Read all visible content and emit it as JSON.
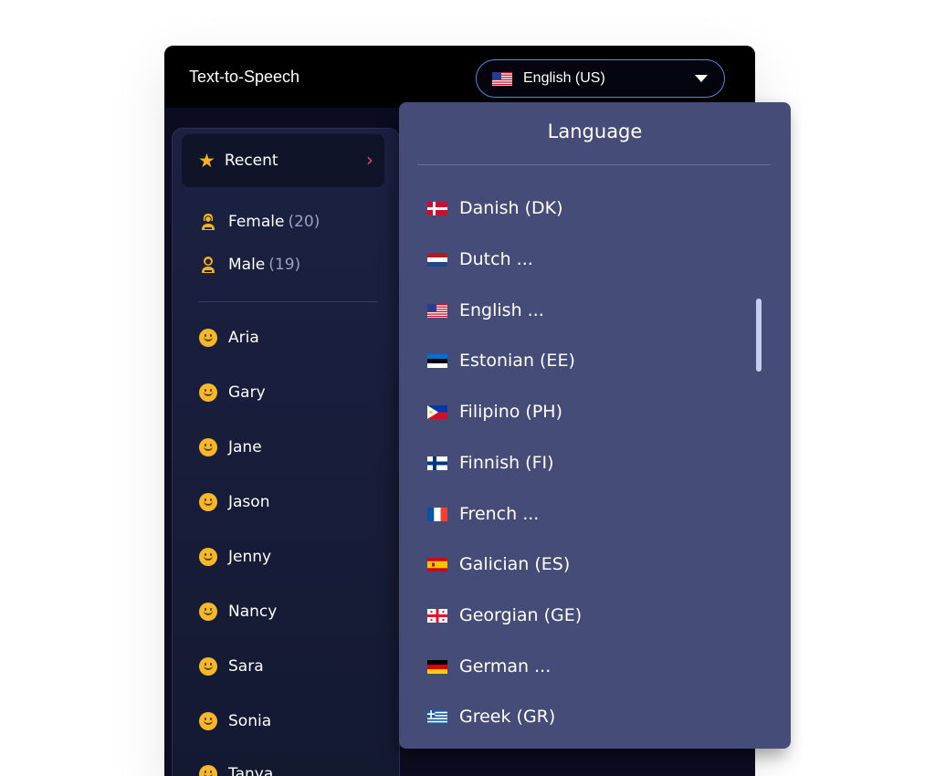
{
  "header": {
    "title": "Text-to-Speech",
    "language_select": {
      "value": "English (US)",
      "flag": "flag-us-icon"
    }
  },
  "sidebar": {
    "recent": {
      "label": "Recent",
      "icon": "star-icon"
    },
    "filters": [
      {
        "label": "Female",
        "count": "(20)",
        "icon": "female-icon"
      },
      {
        "label": "Male",
        "count": "(19)",
        "icon": "male-icon"
      }
    ],
    "voices": [
      "Aria",
      "Gary",
      "Jane",
      "Jason",
      "Jenny",
      "Nancy",
      "Sara",
      "Sonia",
      "Tanya"
    ]
  },
  "language_panel": {
    "title": "Language",
    "items": [
      {
        "label": "Danish (DK)",
        "flag": "flag-dk-icon"
      },
      {
        "label": "Dutch ...",
        "flag": "flag-nl-icon"
      },
      {
        "label": "English ...",
        "flag": "flag-us-icon"
      },
      {
        "label": "Estonian (EE)",
        "flag": "flag-ee-icon"
      },
      {
        "label": "Filipino (PH)",
        "flag": "flag-ph-icon"
      },
      {
        "label": "Finnish (FI)",
        "flag": "flag-fi-icon"
      },
      {
        "label": "French ...",
        "flag": "flag-fr-icon"
      },
      {
        "label": "Galician (ES)",
        "flag": "flag-es-icon"
      },
      {
        "label": "Georgian (GE)",
        "flag": "flag-ge-icon"
      },
      {
        "label": "German ...",
        "flag": "flag-de-icon"
      },
      {
        "label": "Greek (GR)",
        "flag": "flag-gr-icon"
      }
    ]
  },
  "colors": {
    "accent_border": "#4a8fd8",
    "panel_bg": "#464c78",
    "sidebar_bg": "#1b2141",
    "icon_gold": "#f5b41c",
    "chevron_pink": "#e8436a"
  }
}
